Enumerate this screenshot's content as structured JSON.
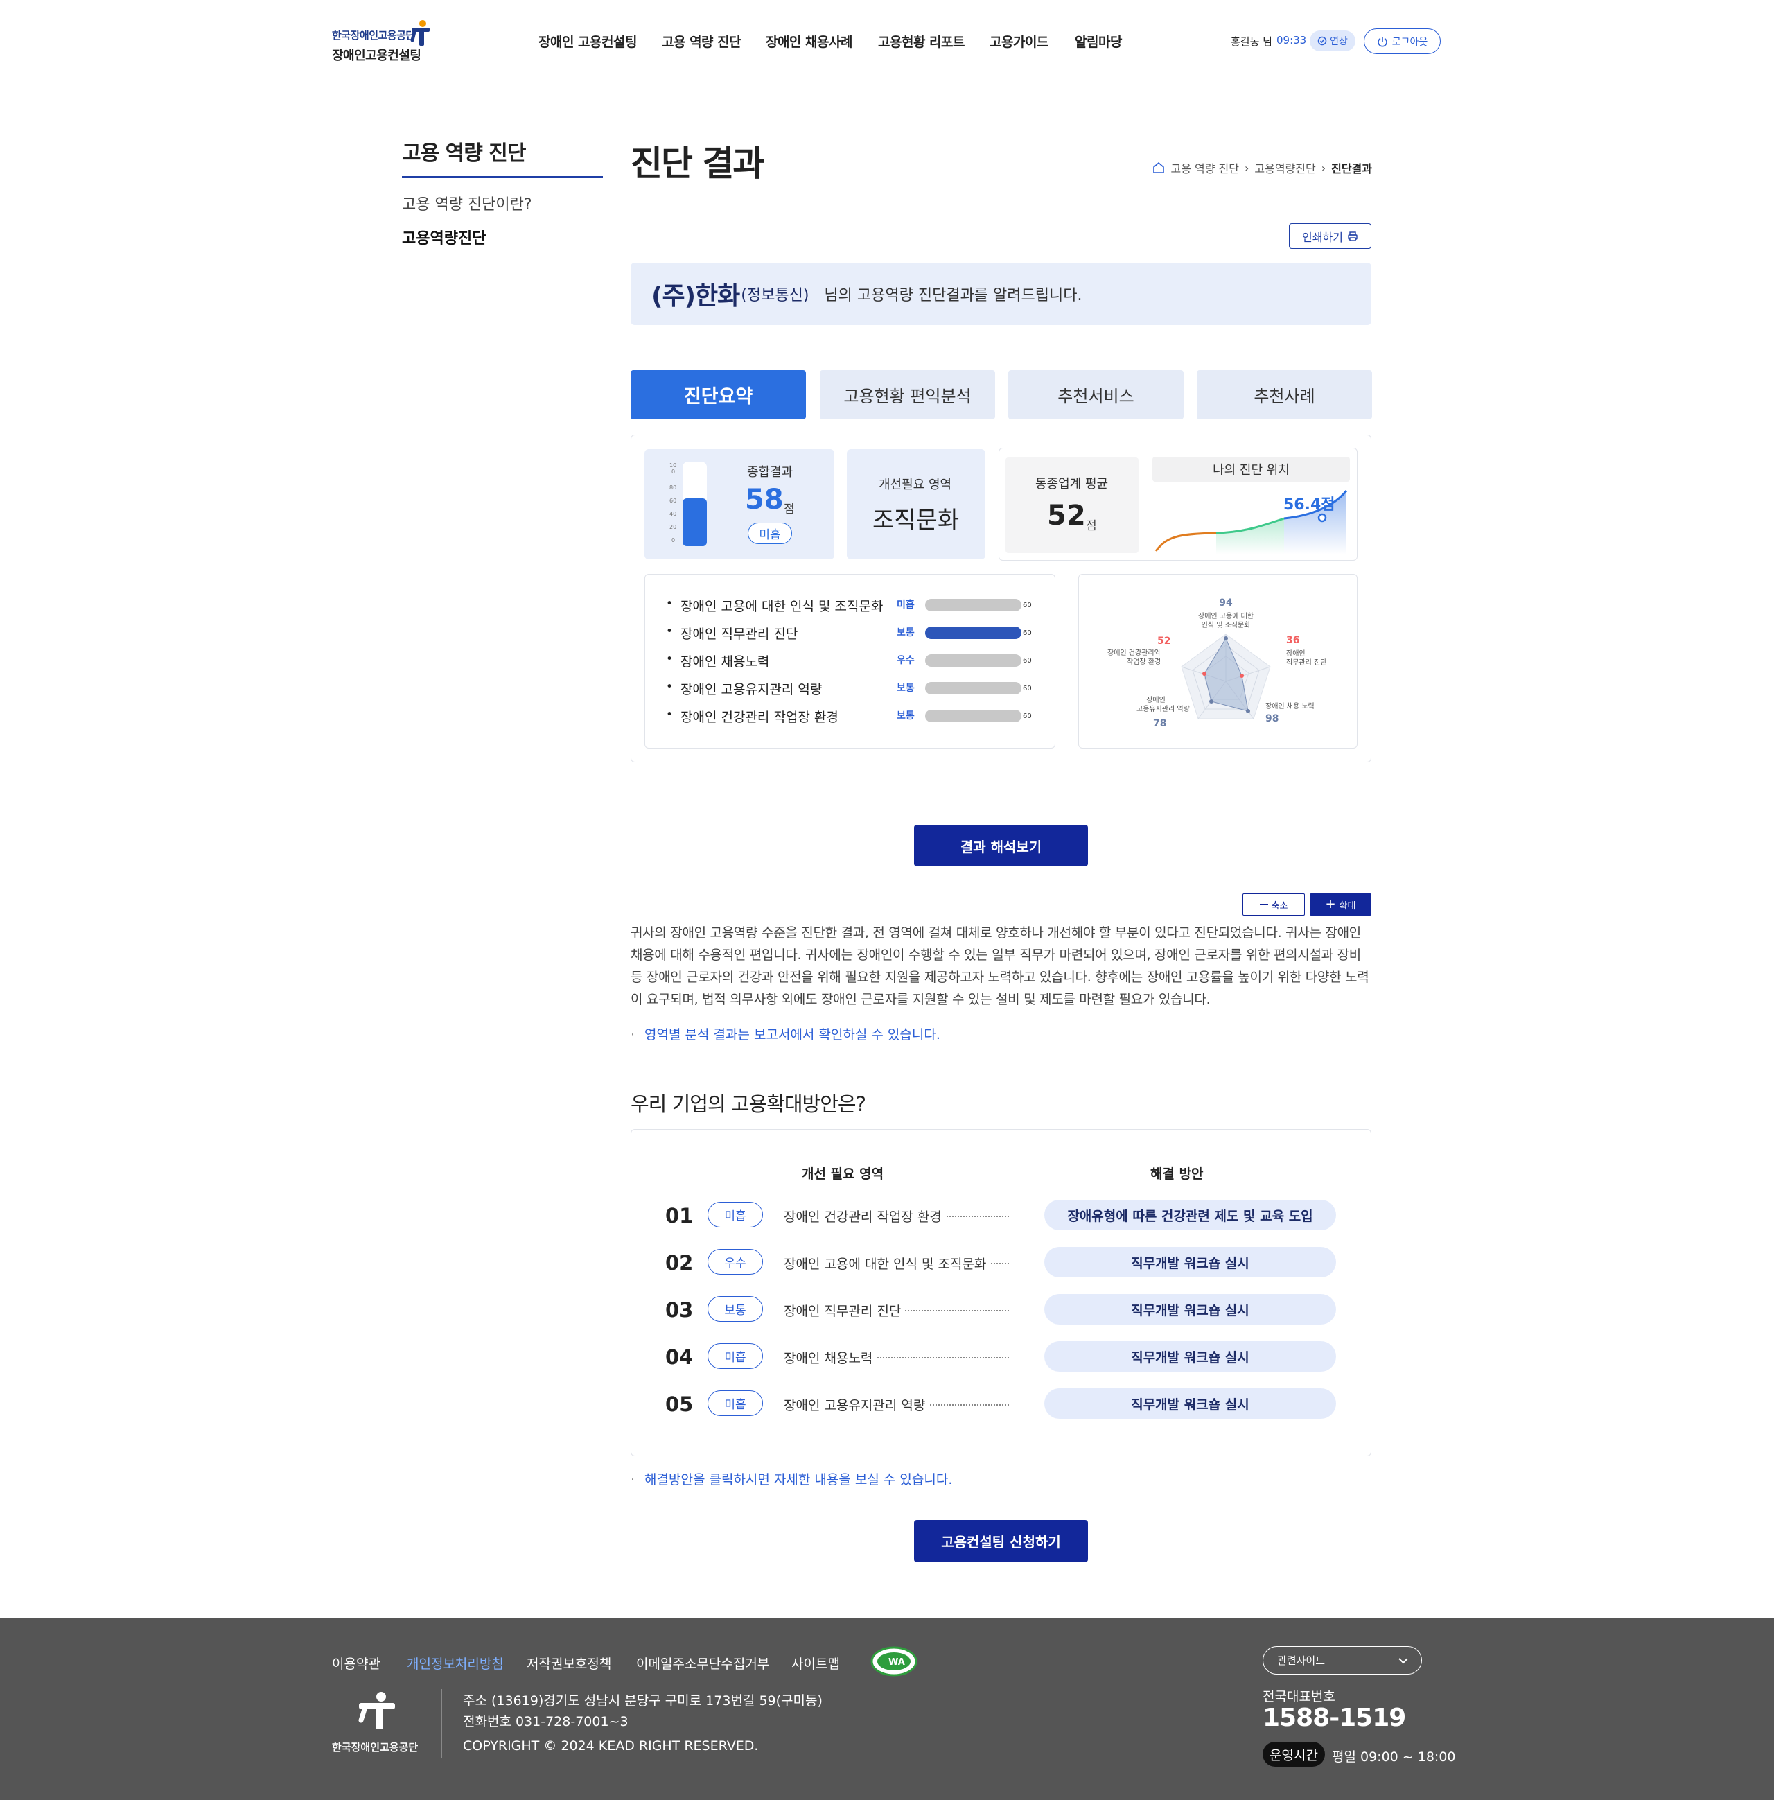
{
  "header": {
    "org_small": "한국장애인고용공단",
    "site_name": "장애인고용컨설팅",
    "nav": [
      "장애인 고용컨설팅",
      "고용 역량 진단",
      "장애인 채용사례",
      "고용현황 리포트",
      "고용가이드",
      "알림마당"
    ],
    "user": "홍길동 님",
    "time": "09:33",
    "extend": "연장",
    "logout": "로그아웃"
  },
  "sidebar": {
    "title": "고용 역량 진단",
    "items": [
      "고용 역량 진단이란?",
      "고용역량진단"
    ]
  },
  "main": {
    "title": "진단 결과",
    "breadcrumb": [
      "고용 역량 진단",
      "고용역량진단",
      "진단결과"
    ],
    "print": "인쇄하기",
    "company": "(주)한화",
    "company_sub": "(정보통신)",
    "greeting": "님의 고용역량 진단결과를 알려드립니다.",
    "tabs": [
      "진단요약",
      "고용현황 편익분석",
      "추천서비스",
      "추천사례"
    ]
  },
  "summary": {
    "thermo_ticks": [
      "10\n0",
      "80",
      "60",
      "40",
      "20",
      "0"
    ],
    "total_label": "종합결과",
    "total_score": "58",
    "unit": "점",
    "total_grade": "미흡",
    "improve_label": "개선필요 영역",
    "improve_value": "조직문화",
    "peer_label": "동종업계 평균",
    "peer_score": "52",
    "position_label": "나의 진단 위치",
    "position_value": "56.4점"
  },
  "areas": [
    {
      "label": "장애인 고용에 대한 인식 및 조직문화",
      "grade": "미흡",
      "value": "60"
    },
    {
      "label": "장애인 직무관리 진단",
      "grade": "보통",
      "value": "60"
    },
    {
      "label": "장애인 채용노력",
      "grade": "우수",
      "value": "60"
    },
    {
      "label": "장애인 고용유지관리 역량",
      "grade": "보통",
      "value": "60"
    },
    {
      "label": "장애인 건강관리 작업장 환경",
      "grade": "보통",
      "value": "60"
    }
  ],
  "radar": {
    "top": {
      "value": "94",
      "l1": "장애인 고용에 대한",
      "l2": "인식 및 조직문화"
    },
    "right": {
      "value": "36",
      "l1": "장애인",
      "l2": "직무관리 진단"
    },
    "br": {
      "value": "98",
      "l1": "장애인 채용 노력"
    },
    "bl": {
      "value": "78",
      "l1": "장애인",
      "l2": "고용유지관리 역량"
    },
    "left": {
      "value": "52",
      "l1": "장애인 건강관리와",
      "l2": "작업장 환경"
    }
  },
  "interpret": {
    "button": "결과 해석보기",
    "zoom_out": "축소",
    "zoom_in": "확대",
    "paragraph": "귀사의 장애인 고용역량 수준을 진단한 결과, 전 영역에 걸쳐 대체로 양호하나 개선해야 할 부분이 있다고 진단되었습니다. 귀사는 장애인 채용에 대해 수용적인 편입니다. 귀사에는 장애인이 수행할 수 있는 일부 직무가 마련되어 있으며, 장애인 근로자를 위한 편의시설과 장비 등 장애인 근로자의 건강과 안전을 위해 필요한 지원을 제공하고자 노력하고 있습니다. 향후에는 장애인 고용률을 높이기 위한 다양한 노력이 요구되며, 법적 의무사항 외에도 장애인 근로자를 지원할 수 있는 설비 및 제도를 마련할 필요가 있습니다.",
    "note": "영역별 분석 결과는 보고서에서 확인하실 수 있습니다."
  },
  "plan": {
    "title": "우리 기업의 고용확대방안은?",
    "col_area": "개선 필요 영역",
    "col_solution": "해결 방안",
    "rows": [
      {
        "num": "01",
        "grade": "미흡",
        "area": "장애인 건강관리 작업장 환경",
        "solution": "장애유형에 따른 건강관련 제도 및 교육 도입"
      },
      {
        "num": "02",
        "grade": "우수",
        "area": "장애인 고용에 대한 인식 및 조직문화",
        "solution": "직무개발 워크숍 실시"
      },
      {
        "num": "03",
        "grade": "보통",
        "area": "장애인 직무관리 진단",
        "solution": "직무개발 워크숍 실시"
      },
      {
        "num": "04",
        "grade": "미흡",
        "area": "장애인 채용노력",
        "solution": "직무개발 워크숍 실시"
      },
      {
        "num": "05",
        "grade": "미흡",
        "area": "장애인 고용유지관리 역량",
        "solution": "직무개발 워크숍 실시"
      }
    ],
    "note": "해결방안을 클릭하시면 자세한 내용을 보실 수 있습니다.",
    "apply": "고용컨설팅 신청하기"
  },
  "footer": {
    "links": [
      "이용약관",
      "개인정보처리방침",
      "저작권보호정책",
      "이메일주소무단수집거부",
      "사이트맵"
    ],
    "org": "한국장애인고용공단",
    "address": "주소 (13619)경기도 성남시 분당구 구미로 173번길 59(구미동)",
    "phone": "전화번호 031-728-7001~3",
    "copyright": "COPYRIGHT © 2024 KEAD RIGHT RESERVED.",
    "related": "관련사이트",
    "tel_label": "전국대표번호",
    "tel": "1588-1519",
    "hours_label": "운영시간",
    "hours": "평일 09:00 ~ 18:00"
  }
}
